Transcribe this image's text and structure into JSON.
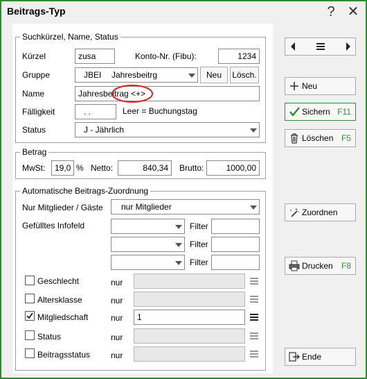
{
  "window": {
    "title": "Beitrags-Typ",
    "help_glyph": "?",
    "close_glyph": "✕"
  },
  "search_group": {
    "legend": "Suchkürzel, Name, Status",
    "kuerzel_label": "Kürzel",
    "kuerzel_value": "zusa",
    "konto_label": "Konto-Nr. (Fibu):",
    "konto_value": "1234",
    "gruppe_label": "Gruppe",
    "gruppe_code": "JBEI",
    "gruppe_name": "Jahresbeitrg",
    "neu_btn": "Neu",
    "loesch_btn": "Lösch.",
    "name_label": "Name",
    "name_value": "Jahresbeitrag <+>",
    "faelligkeit_label": "Fälligkeit",
    "faelligkeit_value": ". .",
    "faelligkeit_hint": "Leer = Buchungstag",
    "status_label": "Status",
    "status_value": "J - Jährlich"
  },
  "betrag_group": {
    "legend": "Betrag",
    "mwst_label": "MwSt:",
    "mwst_value": "19,0",
    "percent": "%",
    "netto_label": "Netto:",
    "netto_value": "840,34",
    "brutto_label": "Brutto:",
    "brutto_value": "1000,00"
  },
  "auto_group": {
    "legend": "Automatische Beitrags-Zuordnung",
    "nur_label": "Nur Mitglieder / Gäste",
    "nur_value": "nur Mitglieder",
    "infofeld_label": "Gefülltes Infofeld",
    "filter_label": "Filter",
    "criteria": [
      {
        "label": "Geschlecht",
        "nur": "nur",
        "checked": false,
        "value": ""
      },
      {
        "label": "Altersklasse",
        "nur": "nur",
        "checked": false,
        "value": ""
      },
      {
        "label": "Mitgliedschaft",
        "nur": "nur",
        "checked": true,
        "value": "1"
      },
      {
        "label": "Status",
        "nur": "nur",
        "checked": false,
        "value": ""
      },
      {
        "label": "Beitragsstatus",
        "nur": "nur",
        "checked": false,
        "value": ""
      }
    ]
  },
  "sidebar": {
    "neu": "Neu",
    "sichern": "Sichern",
    "sichern_key": "F11",
    "loeschen": "Löschen",
    "loeschen_key": "F5",
    "zuordnen": "Zuordnen",
    "drucken": "Drucken",
    "drucken_key": "F8",
    "ende": "Ende"
  },
  "colors": {
    "accent": "#2e8b2e",
    "annotation": "#e02020"
  }
}
